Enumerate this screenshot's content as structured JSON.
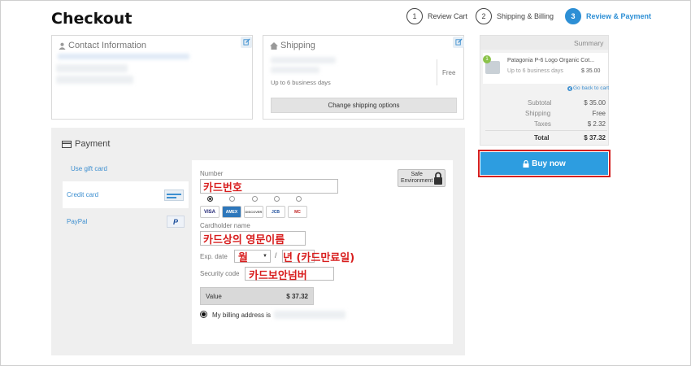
{
  "header": {
    "title": "Checkout",
    "steps": [
      {
        "num": "1",
        "label": "Review Cart"
      },
      {
        "num": "2",
        "label": "Shipping & Billing"
      },
      {
        "num": "3",
        "label": "Review & Payment"
      }
    ]
  },
  "contact": {
    "title": "Contact Information",
    "icon": "user-icon"
  },
  "shipping": {
    "title": "Shipping",
    "icon": "home-icon",
    "time": "Up to 6 business days",
    "price": "Free",
    "change_button": "Change shipping options"
  },
  "summary": {
    "title": "Summary",
    "item": {
      "qty": "1",
      "name": "Patagonia P-6 Logo Organic Cot...",
      "time": "Up to 6 business days",
      "price": "$ 35.00"
    },
    "back_link": "Go back to cart",
    "rows": [
      {
        "label": "Subtotal",
        "value": "$ 35.00"
      },
      {
        "label": "Shipping",
        "value": "Free"
      },
      {
        "label": "Taxes",
        "value": "$ 2.32"
      }
    ],
    "total": {
      "label": "Total",
      "value": "$ 37.32"
    },
    "buy_label": "Buy now"
  },
  "payment": {
    "title": "Payment",
    "tabs": [
      "Use gift card",
      "Credit card",
      "PayPal"
    ],
    "number_label": "Number",
    "safe_label_1": "Safe",
    "safe_label_2": "Environment",
    "cards": [
      "VISA",
      "AMEX",
      "DISCOVER",
      "JCB",
      "MC"
    ],
    "cardholder_label": "Cardholder name",
    "exp_label": "Exp. date",
    "exp_sep": "/",
    "security_label": "Security code",
    "value_label": "Value",
    "value_amount": "$ 37.32",
    "billing_label": "My billing address is"
  },
  "annotations": {
    "card_number": "카드번호",
    "cardholder": "카드상의 영문이름",
    "month": "월",
    "year": "년 (카드만료일)",
    "security": "카드보안넘버"
  },
  "colors": {
    "accent": "#2d9de0",
    "highlight": "#d42020"
  }
}
